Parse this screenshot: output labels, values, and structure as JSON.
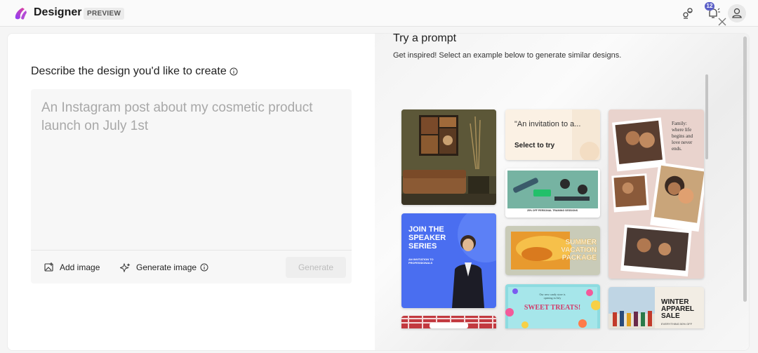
{
  "app": {
    "name": "Designer",
    "badge": "PREVIEW",
    "notification_count": "12"
  },
  "colors": {
    "accent": "#5b5fc7",
    "brand_gradient": [
      "#8a3ffc",
      "#e0409b"
    ]
  },
  "left": {
    "title": "Describe the design you'd like to create",
    "placeholder": "An Instagram post about my cosmetic product launch on July 1st",
    "add_image": "Add image",
    "generate_image": "Generate image",
    "generate": "Generate"
  },
  "right": {
    "title": "Try a prompt",
    "subtitle": "Get inspired! Select an example below to generate similar designs.",
    "tiles": {
      "invitation": {
        "quote": "\"An invitation to a...",
        "cta": "Select to try"
      },
      "family": {
        "caption": "Family: where life begins and love never ends."
      },
      "fitness": {
        "caption": "25% OFF PERSONAL TRAINING SESSIONS"
      },
      "speaker": {
        "headline": "JOIN THE SPEAKER SERIES",
        "sub": "AN INVITATION TO PROFESSIONALS"
      },
      "vacation": {
        "headline": "SUMMER VACATION PACKAGE"
      },
      "sweets": {
        "sub": "Our new candy store is opening in July",
        "headline": "SWEET TREATS!"
      },
      "winter": {
        "headline": "WINTER APPAREL SALE",
        "sub": "EVERYTHING 50% OFF"
      }
    }
  },
  "icons": [
    "designer-logo",
    "share-icon",
    "notification-icon",
    "account-icon",
    "info-icon",
    "add-image-icon",
    "sparkle-icon",
    "close-icon"
  ]
}
